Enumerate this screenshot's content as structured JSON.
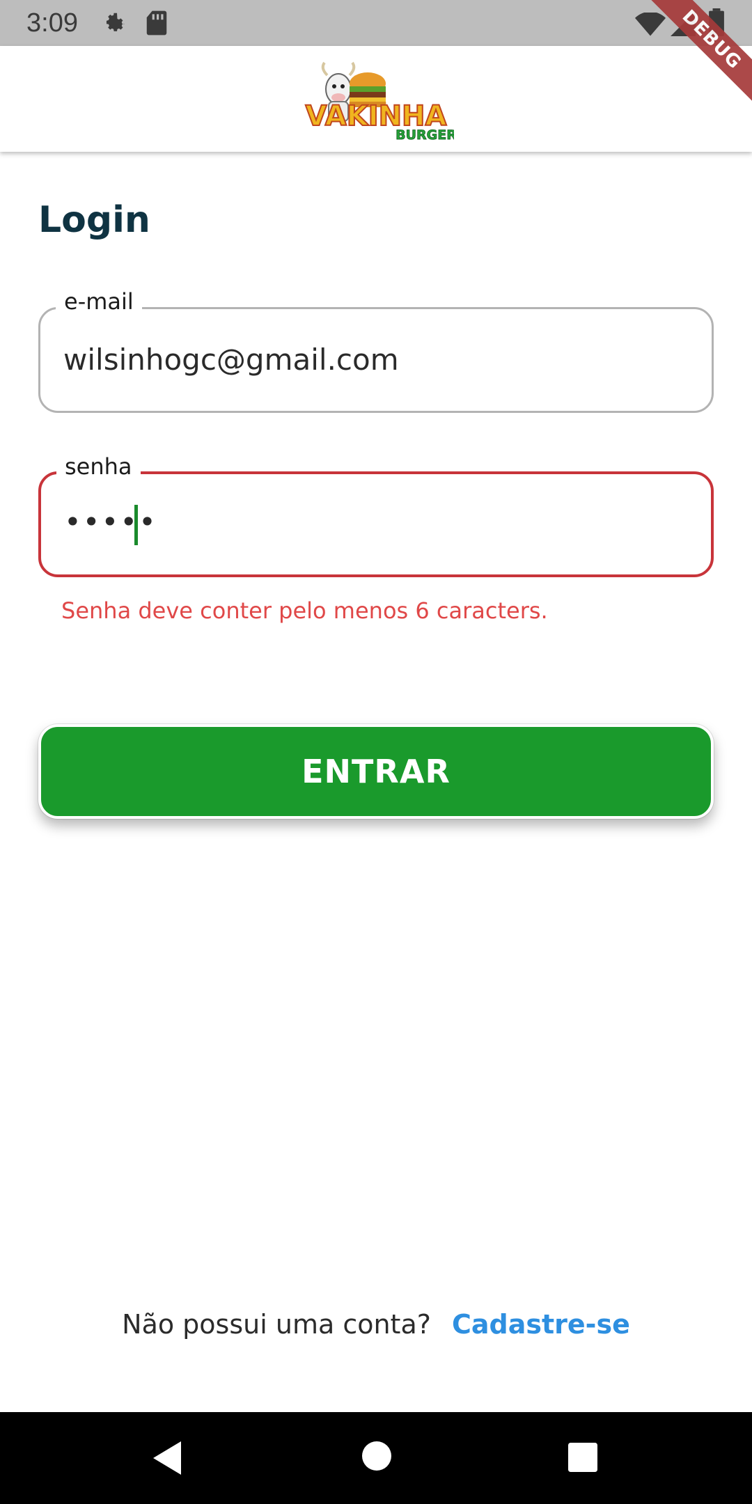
{
  "status_bar": {
    "time": "3:09",
    "icons": [
      "gear-icon",
      "sd-card-icon",
      "wifi-icon",
      "signal-icon",
      "battery-icon"
    ]
  },
  "debug_banner": "DEBUG",
  "app_bar": {
    "logo_text_main": "VAKINHA",
    "logo_text_sub": "BURGER"
  },
  "page": {
    "title": "Login"
  },
  "form": {
    "email": {
      "label": "e-mail",
      "value": "wilsinhogc@gmail.com"
    },
    "password": {
      "label": "senha",
      "value_masked": "•••••",
      "error": "Senha deve conter pelo menos 6 caracters."
    },
    "submit_label": "ENTRAR"
  },
  "footer": {
    "question": "Não possui uma conta?",
    "link": "Cadastre-se"
  },
  "colors": {
    "status_bar_bg": "#bdbdbd",
    "title": "#0f3342",
    "error": "#c8343a",
    "button_bg": "#1a9a2c",
    "link": "#2e8fe0",
    "debug_ribbon": "#a63a3a"
  }
}
